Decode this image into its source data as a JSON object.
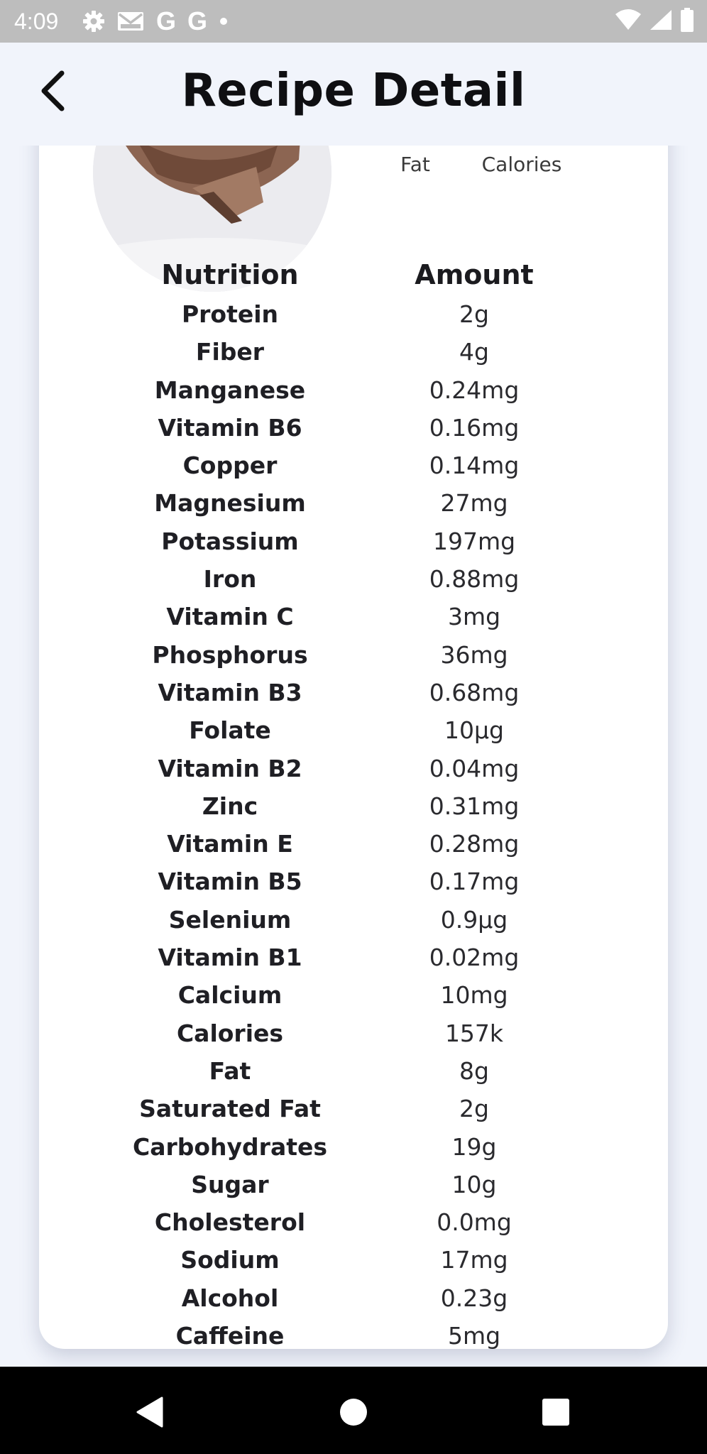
{
  "status_bar": {
    "time": "4:09",
    "left_icons": [
      "gear-icon",
      "gmail-icon",
      "google-icon",
      "google-icon",
      "dot-icon"
    ],
    "google_letter": "G",
    "right_icons": [
      "wifi-icon",
      "signal-icon",
      "battery-icon"
    ]
  },
  "app_bar": {
    "title": "Recipe Detail",
    "back_icon": "back-arrow-icon"
  },
  "summary": {
    "labels": [
      "Fat",
      "Calories"
    ]
  },
  "nutrition": {
    "header": {
      "name": "Nutrition",
      "amount": "Amount"
    },
    "rows": [
      {
        "name": "Protein",
        "amount": "2g"
      },
      {
        "name": "Fiber",
        "amount": "4g"
      },
      {
        "name": "Manganese",
        "amount": "0.24mg"
      },
      {
        "name": "Vitamin B6",
        "amount": "0.16mg"
      },
      {
        "name": "Copper",
        "amount": "0.14mg"
      },
      {
        "name": "Magnesium",
        "amount": "27mg"
      },
      {
        "name": "Potassium",
        "amount": "197mg"
      },
      {
        "name": "Iron",
        "amount": "0.88mg"
      },
      {
        "name": "Vitamin C",
        "amount": "3mg"
      },
      {
        "name": "Phosphorus",
        "amount": "36mg"
      },
      {
        "name": "Vitamin B3",
        "amount": "0.68mg"
      },
      {
        "name": "Folate",
        "amount": "10µg"
      },
      {
        "name": "Vitamin B2",
        "amount": "0.04mg"
      },
      {
        "name": "Zinc",
        "amount": "0.31mg"
      },
      {
        "name": "Vitamin E",
        "amount": "0.28mg"
      },
      {
        "name": "Vitamin B5",
        "amount": "0.17mg"
      },
      {
        "name": "Selenium",
        "amount": "0.9µg"
      },
      {
        "name": "Vitamin B1",
        "amount": "0.02mg"
      },
      {
        "name": "Calcium",
        "amount": "10mg"
      },
      {
        "name": "Calories",
        "amount": "157k"
      },
      {
        "name": "Fat",
        "amount": "8g"
      },
      {
        "name": "Saturated Fat",
        "amount": "2g"
      },
      {
        "name": "Carbohydrates",
        "amount": "19g"
      },
      {
        "name": "Sugar",
        "amount": "10g"
      },
      {
        "name": "Cholesterol",
        "amount": "0.0mg"
      },
      {
        "name": "Sodium",
        "amount": "17mg"
      },
      {
        "name": "Alcohol",
        "amount": "0.23g"
      },
      {
        "name": "Caffeine",
        "amount": "5mg"
      }
    ]
  },
  "nav_bar": {
    "buttons": [
      "back-triangle-icon",
      "home-circle-icon",
      "recents-square-icon"
    ]
  }
}
